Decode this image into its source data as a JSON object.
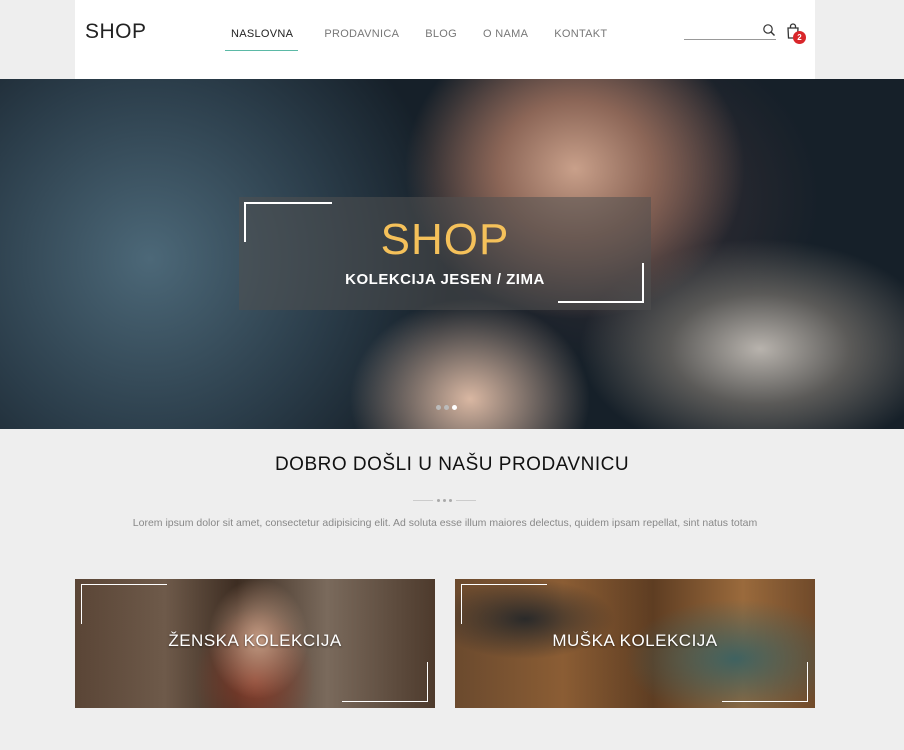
{
  "header": {
    "logo": "SHOP",
    "nav": [
      {
        "label": "NASLOVNA",
        "active": true
      },
      {
        "label": "PRODAVNICA",
        "active": false
      },
      {
        "label": "BLOG",
        "active": false
      },
      {
        "label": "O NAMA",
        "active": false
      },
      {
        "label": "KONTAKT",
        "active": false
      }
    ],
    "search": {
      "value": "",
      "placeholder": "",
      "icon": "search-icon"
    },
    "cart": {
      "icon": "shopping-bag-icon",
      "count": "2"
    }
  },
  "hero": {
    "title": "SHOP",
    "subtitle": "KOLEKCIJA JESEN / ZIMA",
    "slides": 3,
    "active_slide": 3
  },
  "welcome": {
    "title": "DOBRO DOŠLI U NAŠU PRODAVNICU",
    "text": "Lorem ipsum dolor sit amet, consectetur adipisicing elit. Ad soluta esse illum maiores delectus, quidem ipsam repellat, sint natus totam"
  },
  "collections": [
    {
      "label": "ŽENSKA KOLEKCIJA"
    },
    {
      "label": "MUŠKA KOLEKCIJA"
    }
  ],
  "colors": {
    "accent": "#5bb9a6",
    "hero_title": "#f5c15a",
    "badge": "#d9262a",
    "background": "#eeeeee"
  }
}
